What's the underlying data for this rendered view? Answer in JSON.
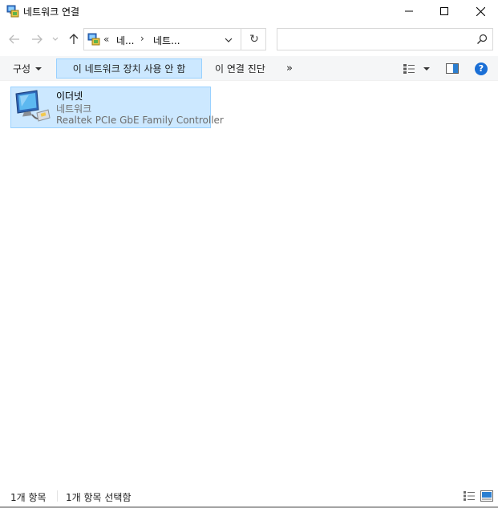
{
  "window": {
    "title": "네트워크 연결"
  },
  "nav": {
    "address_chevron": "«",
    "crumbs": [
      "네...",
      "네트..."
    ],
    "crumb_separator": "›",
    "refresh_glyph": "↻",
    "search_placeholder": ""
  },
  "commands": {
    "organize": "구성",
    "disable": "이 네트워크 장치 사용 안 함",
    "diagnose": "이 연결 진단",
    "more": "»",
    "help": "?"
  },
  "items": [
    {
      "name": "이더넷",
      "type": "네트워크",
      "device": "Realtek PCIe GbE Family Controller",
      "icon": "network-adapter-icon"
    }
  ],
  "status": {
    "count": "1개 항목",
    "selected": "1개 항목 선택함"
  },
  "colors": {
    "selection_fill": "#cce8ff",
    "selection_border": "#99d1ff",
    "help_blue": "#1a6fd6"
  }
}
